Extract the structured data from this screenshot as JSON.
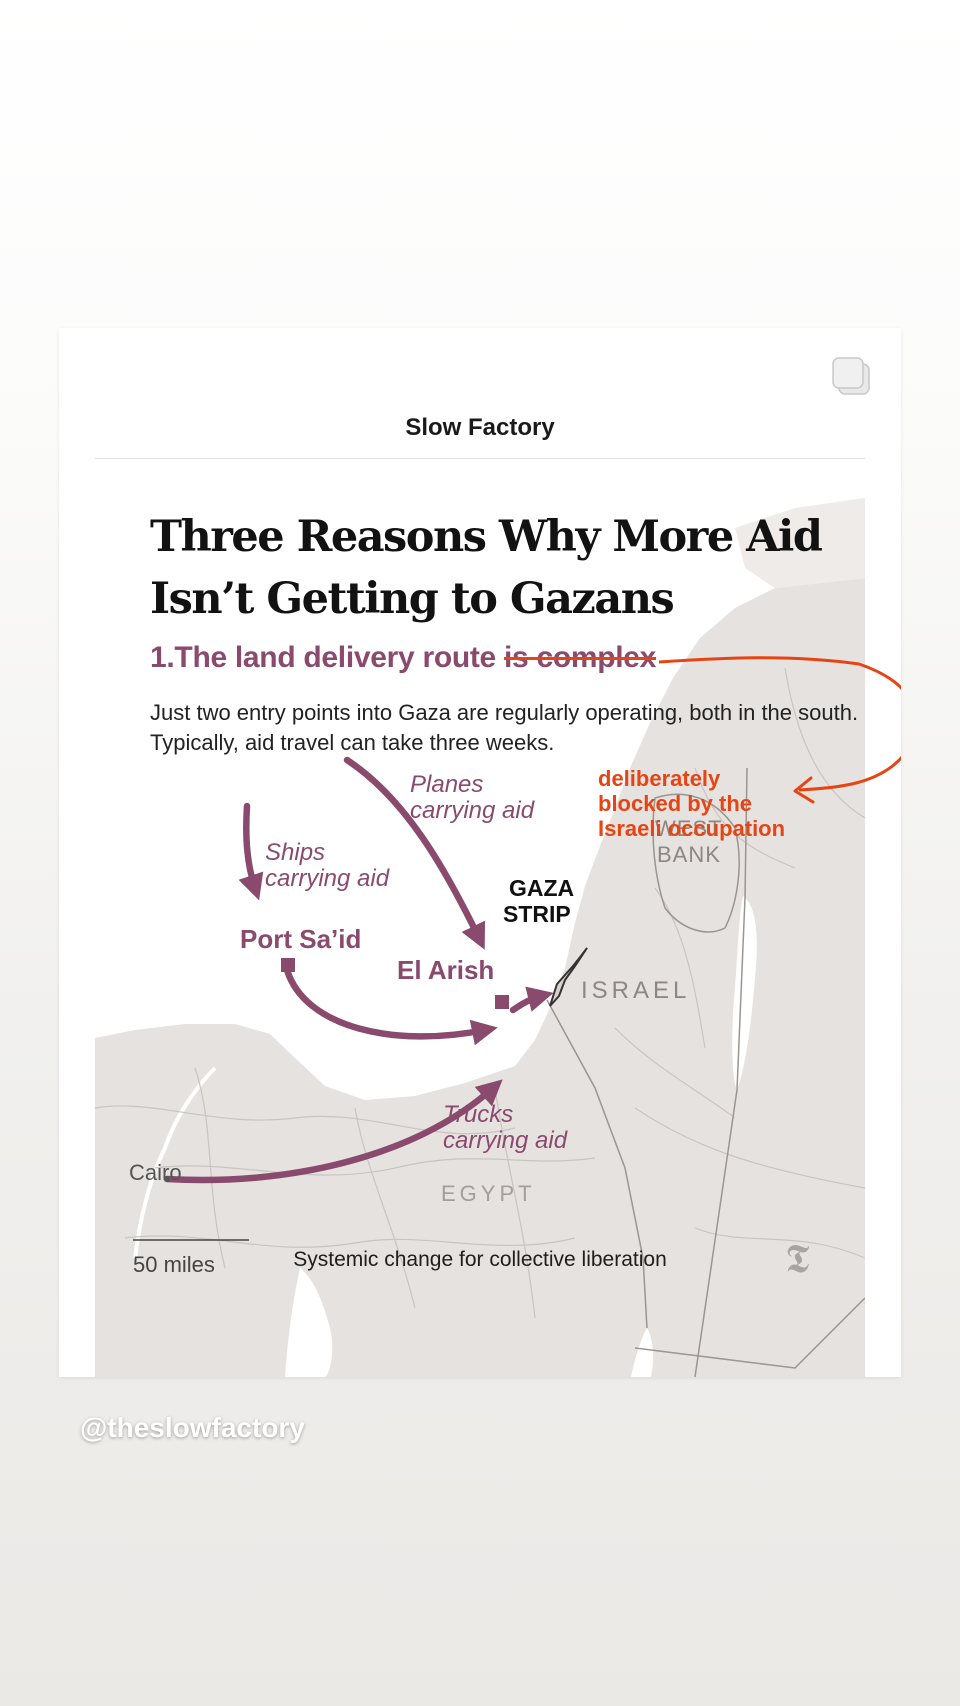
{
  "card": {
    "brand": "Slow Factory",
    "headline_line1": "Three Reasons Why More Aid",
    "headline_line2": "Isn’t Getting to Gazans",
    "subhead_main": "1.The land delivery route ",
    "subhead_struck": "is complex",
    "body": "Just two entry points into Gaza are regularly operating, both in the south. Typically, aid travel can take three weeks.",
    "annotation_line1": "deliberately",
    "annotation_line2": "blocked by the",
    "annotation_line3": "Israeli occupation",
    "tagline": "Systemic change for collective liberation"
  },
  "map": {
    "labels": {
      "planes_1": "Planes",
      "planes_2": "carrying aid",
      "ships_1": "Ships",
      "ships_2": "carrying aid",
      "trucks_1": "Trucks",
      "trucks_2": "carrying aid",
      "gaza_1": "GAZA",
      "gaza_2": "STRIP",
      "west_bank_1": "WEST",
      "west_bank_2": "BANK",
      "israel": "ISRAEL",
      "egypt": "EGYPT",
      "port_said": "Port Sa’id",
      "el_arish": "El Arish",
      "cairo": "Cairo",
      "scale": "50 miles"
    },
    "logo_glyph": "𝕿"
  },
  "footer": {
    "handle": "@theslowfactory"
  },
  "colors": {
    "route": "#8a4a6d",
    "annotation": "#e64513",
    "land": "#e6e2df",
    "water": "#ffffff"
  },
  "icons": {
    "copy": "copy-icon",
    "logo": "nyt-logo-icon"
  }
}
